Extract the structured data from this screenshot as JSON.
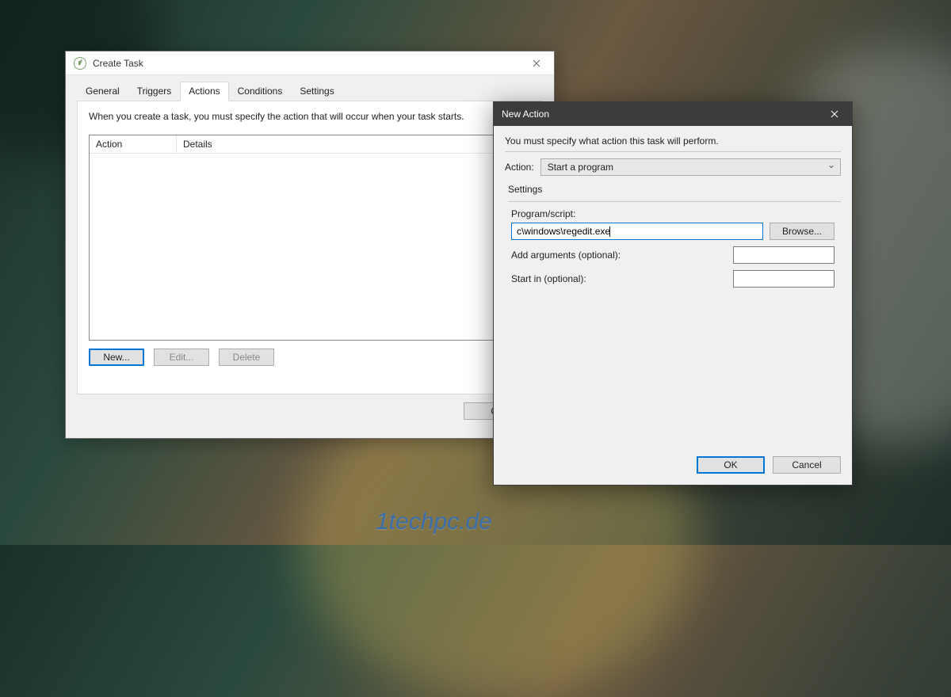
{
  "createTask": {
    "title": "Create Task",
    "tabs": [
      "General",
      "Triggers",
      "Actions",
      "Conditions",
      "Settings"
    ],
    "activeTab": "Actions",
    "description": "When you create a task, you must specify the action that will occur when your task starts.",
    "list": {
      "col1": "Action",
      "col2": "Details"
    },
    "buttons": {
      "new": "New...",
      "edit": "Edit...",
      "delete": "Delete"
    },
    "ok": "OK"
  },
  "newAction": {
    "title": "New Action",
    "hint": "You must specify what action this task will perform.",
    "actionLabel": "Action:",
    "actionValue": "Start a program",
    "settingsLabel": "Settings",
    "programLabel": "Program/script:",
    "programValue": "c\\windows\\regedit.exe",
    "browse": "Browse...",
    "argsLabel": "Add arguments (optional):",
    "argsValue": "",
    "startInLabel": "Start in (optional):",
    "startInValue": "",
    "ok": "OK",
    "cancel": "Cancel"
  },
  "watermark": "1techpc.de"
}
